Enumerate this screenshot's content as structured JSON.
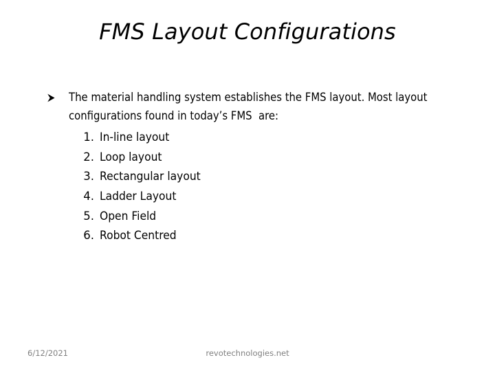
{
  "slide": {
    "title": "FMS Layout Configurations",
    "background_color": "#ffffff",
    "text_color": "#000000",
    "footer_color": "#808080"
  },
  "body": {
    "bullet_icon": "wingdings-arrowhead-bullet",
    "bullet_glyph": "➢",
    "paragraph": "The material handling system establishes the FMS layout. Most layout configurations found in today’s FMS  are:"
  },
  "numbered_list": [
    {
      "index": "1.",
      "label": "In-line layout"
    },
    {
      "index": "2.",
      "label": "Loop layout"
    },
    {
      "index": "3.",
      "label": "Rectangular layout"
    },
    {
      "index": "4.",
      "label": "Ladder Layout"
    },
    {
      "index": "5.",
      "label": "Open Field"
    },
    {
      "index": "6.",
      "label": "Robot Centred"
    }
  ],
  "footer": {
    "date": "6/12/2021",
    "source": "revotechnologies.net"
  }
}
